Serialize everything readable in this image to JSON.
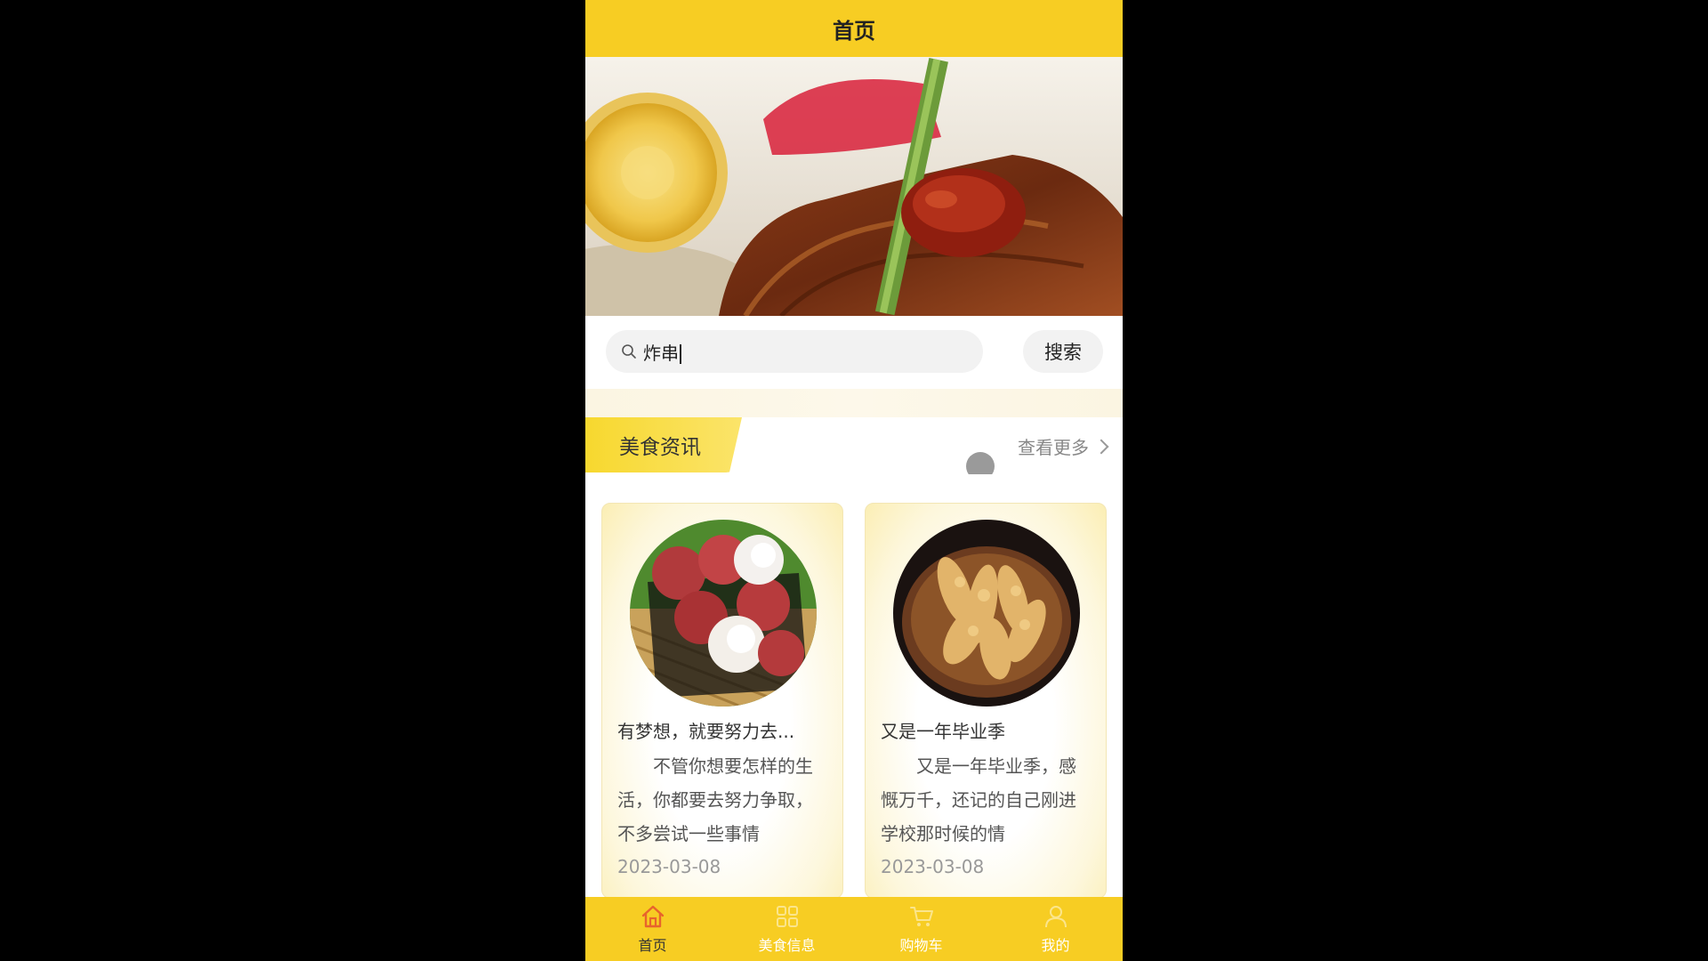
{
  "header": {
    "title": "首页"
  },
  "banner": {
    "image": "food-banner-image"
  },
  "search": {
    "value": "炸串",
    "button_label": "搜索"
  },
  "section": {
    "title": "美食资讯",
    "more_label": "查看更多"
  },
  "news": [
    {
      "title": "有梦想，就要努力去...",
      "summary": "不管你想要怎样的生活，你都要去努力争取，不多尝试一些事情",
      "date": "2023-03-08",
      "image": "lychee-image"
    },
    {
      "title": "又是一年毕业季",
      "summary": "又是一年毕业季，感慨万千，还记的自己刚进学校那时候的情",
      "date": "2023-03-08",
      "image": "fried-food-image"
    }
  ],
  "tabbar": {
    "items": [
      {
        "label": "首页",
        "icon": "home-icon",
        "active": true
      },
      {
        "label": "美食信息",
        "icon": "grid-icon",
        "active": false
      },
      {
        "label": "购物车",
        "icon": "cart-icon",
        "active": false
      },
      {
        "label": "我的",
        "icon": "user-icon",
        "active": false
      }
    ]
  },
  "colors": {
    "primary": "#f7cd23",
    "active_tab": "#e8642c"
  }
}
